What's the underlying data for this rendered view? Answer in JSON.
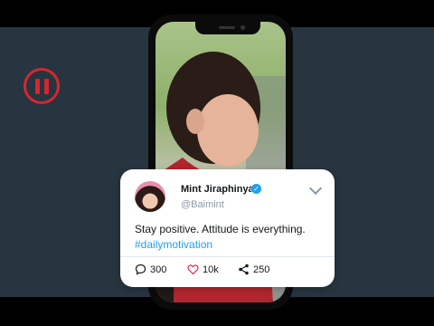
{
  "tweet": {
    "name": "Mint Jiraphinya",
    "verified_mark": "✓",
    "handle": "@Baimint",
    "text": "Stay positive. Attitude is everything.",
    "hashtag": "#dailymotivation",
    "comments": "300",
    "likes": "10k",
    "shares": "250"
  },
  "icons": {
    "pause": "pause-icon",
    "comment": "comment-icon",
    "like": "heart-icon",
    "share": "share-icon",
    "menu": "chevron-down-icon"
  },
  "colors": {
    "background": "#263540",
    "accent_red": "#d7262e",
    "twitter_blue": "#1da1f2",
    "like_red": "#e0245e"
  }
}
